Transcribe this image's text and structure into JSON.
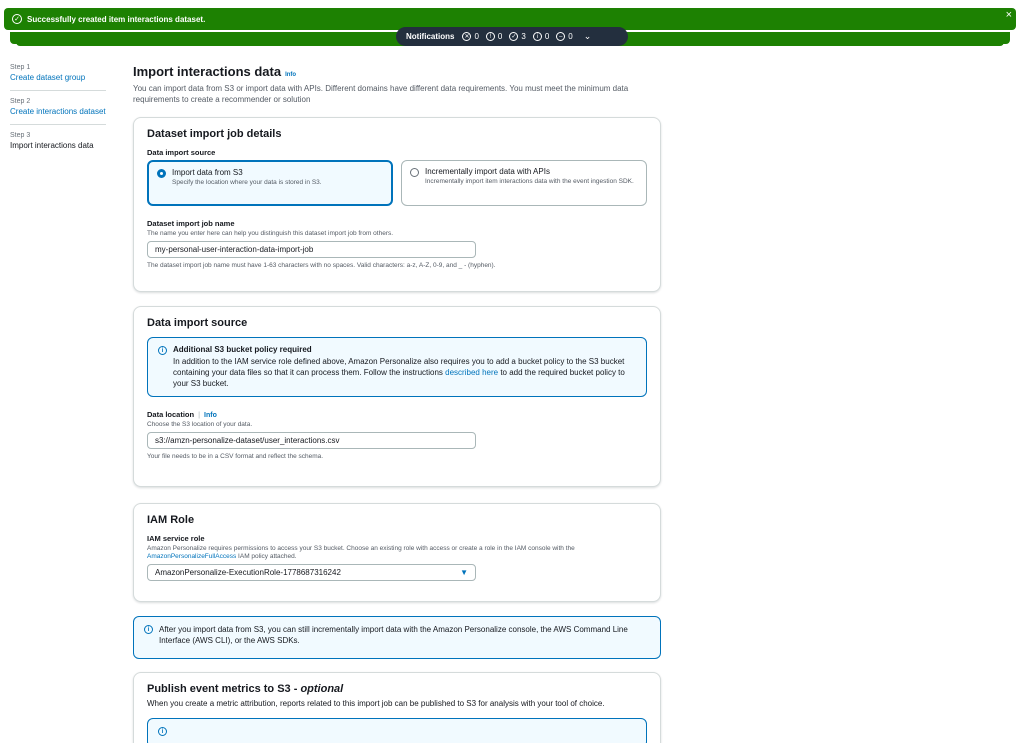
{
  "flash": {
    "message": "Successfully created item interactions dataset.",
    "close_icon": "×",
    "check_icon": "✓"
  },
  "notifications": {
    "label": "Notifications",
    "errors": "0",
    "warnings": "0",
    "success": "3",
    "info": "0",
    "in_progress": "0"
  },
  "steps": [
    {
      "num": "Step 1",
      "label": "Create dataset group"
    },
    {
      "num": "Step 2",
      "label": "Create interactions dataset"
    },
    {
      "num": "Step 3",
      "label": "Import interactions data"
    }
  ],
  "page": {
    "title": "Import interactions data",
    "info": "Info",
    "description": "You can import data from S3 or import data with APIs. Different domains have different data requirements. You must meet the minimum data requirements to create a recommender or solution"
  },
  "job_details": {
    "title": "Dataset import job details",
    "source_label": "Data import source",
    "option_s3_title": "Import data from S3",
    "option_s3_desc": "Specify the location where your data is stored in S3.",
    "option_api_title": "Incrementally import data with APIs",
    "option_api_desc": "Incrementally import item interactions data with the event ingestion SDK.",
    "job_name_label": "Dataset import job name",
    "job_name_desc": "The name you enter here can help you distinguish this dataset import job from others.",
    "job_name_value": "my-personal-user-interaction-data-import-job",
    "job_name_hint": "The dataset import job name must have 1-63 characters with no spaces. Valid characters: a-z, A-Z, 0-9, and _ - (hyphen)."
  },
  "data_source": {
    "title": "Data import source",
    "alert_title": "Additional S3 bucket policy required",
    "alert_body_1": "In addition to the IAM service role defined above, Amazon Personalize also requires you to add a bucket policy to the S3 bucket containing your data files so that it can process them. Follow the instructions",
    "alert_link": "described here",
    "alert_body_2": "to add the required bucket policy to your S3 bucket.",
    "location_label": "Data location",
    "location_info": "Info",
    "location_desc": "Choose the S3 location of your data.",
    "location_value": "s3://amzn-personalize-dataset/user_interactions.csv",
    "location_hint": "Your file needs to be in a CSV format and reflect the schema."
  },
  "iam": {
    "title": "IAM Role",
    "role_label": "IAM service role",
    "role_desc_1": "Amazon Personalize requires permissions to access your S3 bucket. Choose an existing role with access or create a role in the IAM console with the",
    "role_desc_link": "AmazonPersonalizeFullAccess",
    "role_desc_2": "IAM policy attached.",
    "role_value": "AmazonPersonalize-ExecutionRole-1778687316242"
  },
  "info_alert": {
    "text": "After you import data from S3, you can still incrementally import data with the Amazon Personalize console, the AWS Command Line Interface (AWS CLI), or the AWS SDKs."
  },
  "metrics": {
    "title": "Publish event metrics to S3 - ",
    "title_optional": "optional",
    "desc": "When you create a metric attribution, reports related to this import job can be published to S3 for analysis with your tool of choice."
  }
}
